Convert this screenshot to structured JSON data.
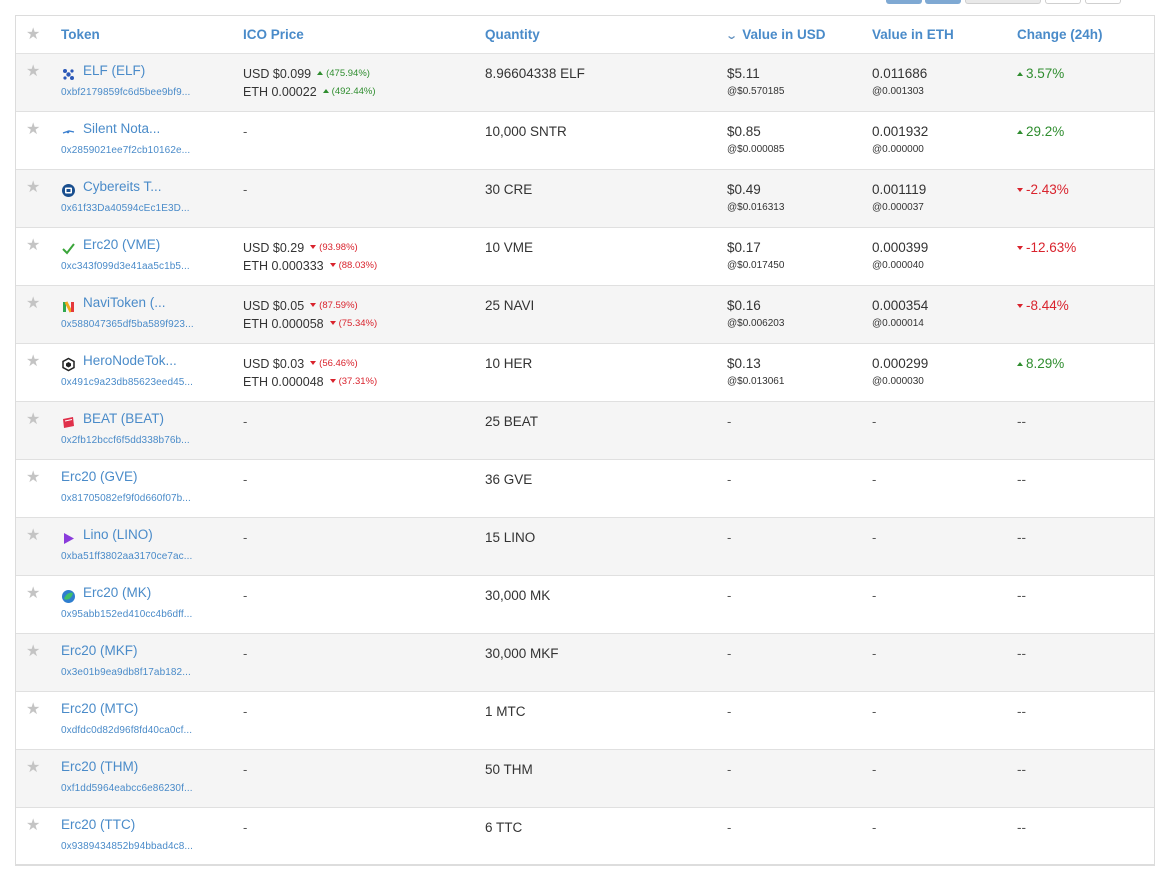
{
  "colors": {
    "link": "#4a8bc9",
    "up": "#2f8d2f",
    "down": "#d9232d",
    "row_alt": "#f5f5f5"
  },
  "table": {
    "headers": {
      "token": "Token",
      "ico_price": "ICO Price",
      "quantity": "Quantity",
      "value_usd": "Value in USD",
      "value_eth": "Value in ETH",
      "change": "Change (24h)"
    },
    "rows": [
      {
        "icon": "elf-dots-icon",
        "name": "ELF (ELF)",
        "address": "0xbf2179859fc6d5bee9bf9...",
        "ico_usd": "USD $0.099",
        "ico_usd_pct": "(475.94%)",
        "ico_usd_dir": "up",
        "ico_eth": "ETH 0.00022",
        "ico_eth_pct": "(492.44%)",
        "ico_eth_dir": "up",
        "quantity": "8.96604338 ELF",
        "value_usd": "$5.11",
        "rate_usd": "@$0.570185",
        "value_eth": "0.011686",
        "rate_eth": "@0.001303",
        "change": "3.57%",
        "change_dir": "up"
      },
      {
        "icon": "satellite-icon",
        "name": "Silent Nota...",
        "address": "0x2859021ee7f2cb10162e...",
        "ico_dash": "-",
        "quantity": "10,000 SNTR",
        "value_usd": "$0.85",
        "rate_usd": "@$0.000085",
        "value_eth": "0.001932",
        "rate_eth": "@0.000000",
        "change": "29.2%",
        "change_dir": "up"
      },
      {
        "icon": "cybereits-badge-icon",
        "name": "Cybereits T...",
        "address": "0x61f33Da40594cEc1E3D...",
        "ico_dash": "-",
        "quantity": "30 CRE",
        "value_usd": "$0.49",
        "rate_usd": "@$0.016313",
        "value_eth": "0.001119",
        "rate_eth": "@0.000037",
        "change": "-2.43%",
        "change_dir": "down"
      },
      {
        "icon": "checkmark-icon",
        "name": "Erc20 (VME)",
        "address": "0xc343f099d3e41aa5c1b5...",
        "ico_usd": "USD $0.29",
        "ico_usd_pct": "(93.98%)",
        "ico_usd_dir": "down",
        "ico_eth": "ETH 0.000333",
        "ico_eth_pct": "(88.03%)",
        "ico_eth_dir": "down",
        "quantity": "10 VME",
        "value_usd": "$0.17",
        "rate_usd": "@$0.017450",
        "value_eth": "0.000399",
        "rate_eth": "@0.000040",
        "change": "-12.63%",
        "change_dir": "down"
      },
      {
        "icon": "navi-n-icon",
        "name": "NaviToken (...",
        "address": "0x588047365df5ba589f923...",
        "ico_usd": "USD $0.05",
        "ico_usd_pct": "(87.59%)",
        "ico_usd_dir": "down",
        "ico_eth": "ETH 0.000058",
        "ico_eth_pct": "(75.34%)",
        "ico_eth_dir": "down",
        "quantity": "25 NAVI",
        "value_usd": "$0.16",
        "rate_usd": "@$0.006203",
        "value_eth": "0.000354",
        "rate_eth": "@0.000014",
        "change": "-8.44%",
        "change_dir": "down"
      },
      {
        "icon": "hexagon-icon",
        "name": "HeroNodeTok...",
        "address": "0x491c9a23db85623eed45...",
        "ico_usd": "USD $0.03",
        "ico_usd_pct": "(56.46%)",
        "ico_usd_dir": "down",
        "ico_eth": "ETH 0.000048",
        "ico_eth_pct": "(37.31%)",
        "ico_eth_dir": "down",
        "quantity": "10 HER",
        "value_usd": "$0.13",
        "rate_usd": "@$0.013061",
        "value_eth": "0.000299",
        "rate_eth": "@0.000030",
        "change": "8.29%",
        "change_dir": "up"
      },
      {
        "icon": "beat-tag-icon",
        "name": "BEAT (BEAT)",
        "address": "0x2fb12bccf6f5dd338b76b...",
        "ico_dash": "-",
        "quantity": "25 BEAT",
        "value_usd_dash": "-",
        "value_eth_dash": "-",
        "change": "--",
        "change_dir": "none"
      },
      {
        "icon": "",
        "name": "Erc20 (GVE)",
        "address": "0x81705082ef9f0d660f07b...",
        "ico_dash": "-",
        "quantity": "36 GVE",
        "value_usd_dash": "-",
        "value_eth_dash": "-",
        "change": "--",
        "change_dir": "none"
      },
      {
        "icon": "play-triangle-icon",
        "name": "Lino (LINO)",
        "address": "0xba51ff3802aa3170ce7ac...",
        "ico_dash": "-",
        "quantity": "15 LINO",
        "value_usd_dash": "-",
        "value_eth_dash": "-",
        "change": "--",
        "change_dir": "none"
      },
      {
        "icon": "globe-leaf-icon",
        "name": "Erc20 (MK)",
        "address": "0x95abb152ed410cc4b6dff...",
        "ico_dash": "-",
        "quantity": "30,000 MK",
        "value_usd_dash": "-",
        "value_eth_dash": "-",
        "change": "--",
        "change_dir": "none"
      },
      {
        "icon": "",
        "name": "Erc20 (MKF)",
        "address": "0x3e01b9ea9db8f17ab182...",
        "ico_dash": "-",
        "quantity": "30,000 MKF",
        "value_usd_dash": "-",
        "value_eth_dash": "-",
        "change": "--",
        "change_dir": "none"
      },
      {
        "icon": "",
        "name": "Erc20 (MTC)",
        "address": "0xdfdc0d82d96f8fd40ca0cf...",
        "ico_dash": "-",
        "quantity": "1 MTC",
        "value_usd_dash": "-",
        "value_eth_dash": "-",
        "change": "--",
        "change_dir": "none"
      },
      {
        "icon": "",
        "name": "Erc20 (THM)",
        "address": "0xf1dd5964eabcc6e86230f...",
        "ico_dash": "-",
        "quantity": "50 THM",
        "value_usd_dash": "-",
        "value_eth_dash": "-",
        "change": "--",
        "change_dir": "none"
      },
      {
        "icon": "",
        "name": "Erc20 (TTC)",
        "address": "0x9389434852b94bbad4c8...",
        "ico_dash": "-",
        "quantity": "6 TTC",
        "value_usd_dash": "-",
        "value_eth_dash": "-",
        "change": "--",
        "change_dir": "none"
      }
    ]
  }
}
